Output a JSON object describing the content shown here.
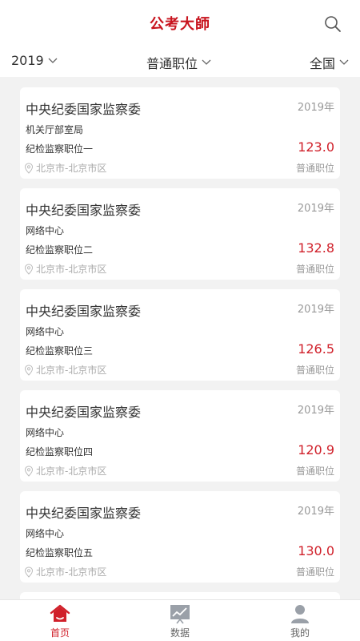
{
  "header": {
    "title": "公考大師"
  },
  "filters": {
    "year": "2019",
    "type": "普通职位",
    "region": "全国"
  },
  "cards": [
    {
      "org": "中央纪委国家监察委",
      "year": "2019年",
      "dept": "机关厅部室局",
      "position": "纪检监察职位一",
      "score": "123.0",
      "location": "北京市-北京市区",
      "category": "普通职位"
    },
    {
      "org": "中央纪委国家监察委",
      "year": "2019年",
      "dept": "网络中心",
      "position": "纪检监察职位二",
      "score": "132.8",
      "location": "北京市-北京市区",
      "category": "普通职位"
    },
    {
      "org": "中央纪委国家监察委",
      "year": "2019年",
      "dept": "网络中心",
      "position": "纪检监察职位三",
      "score": "126.5",
      "location": "北京市-北京市区",
      "category": "普通职位"
    },
    {
      "org": "中央纪委国家监察委",
      "year": "2019年",
      "dept": "网络中心",
      "position": "纪检监察职位四",
      "score": "120.9",
      "location": "北京市-北京市区",
      "category": "普通职位"
    },
    {
      "org": "中央纪委国家监察委",
      "year": "2019年",
      "dept": "网络中心",
      "position": "纪检监察职位五",
      "score": "130.0",
      "location": "北京市-北京市区",
      "category": "普通职位"
    }
  ],
  "nav": {
    "home": "首页",
    "data": "数据",
    "me": "我的"
  },
  "colors": {
    "brand": "#c8141e",
    "score": "#d0202a"
  }
}
